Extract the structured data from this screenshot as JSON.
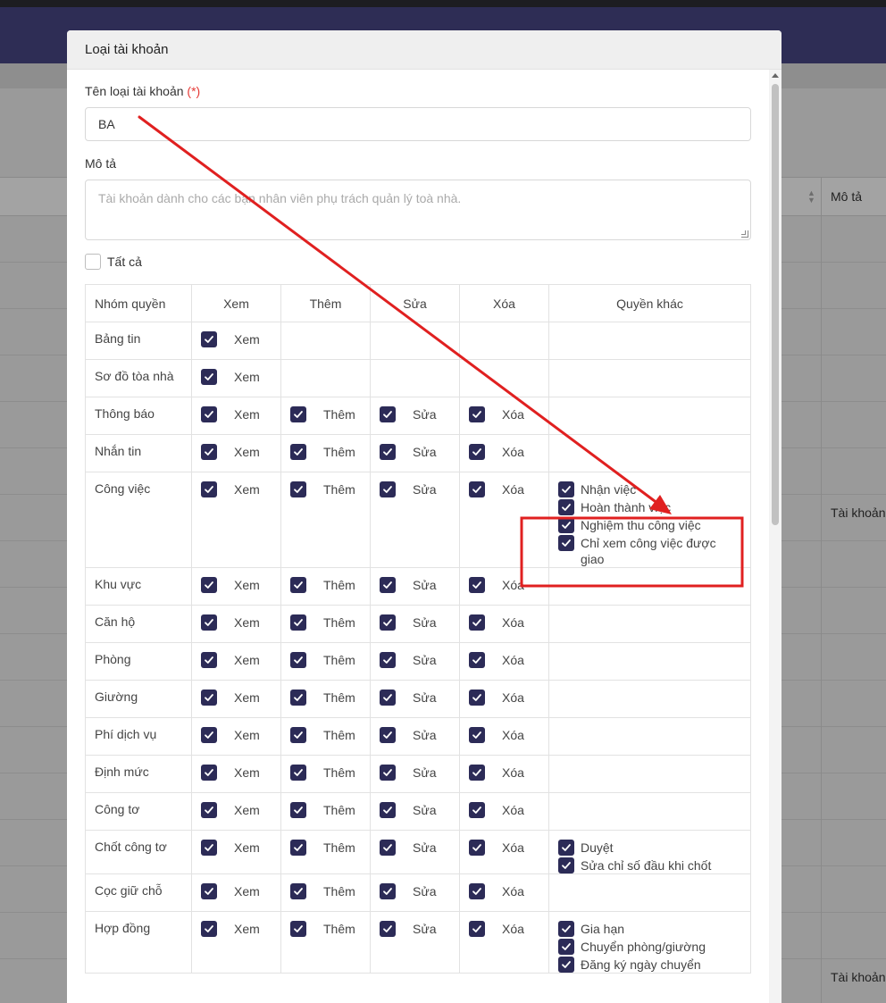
{
  "background": {
    "column_header": "Mô tả",
    "cells": [
      "Tài khoản",
      "Tài khoản"
    ]
  },
  "modal": {
    "title": "Loại tài khoản",
    "name_label": "Tên loại tài khoản",
    "required_mark": "(*)",
    "name_value": "BA",
    "desc_label": "Mô tả",
    "desc_placeholder": "Tài khoản dành cho các bạn nhân viên phụ trách quản lý toà nhà.",
    "select_all_label": "Tất cả",
    "table": {
      "headers": [
        "Nhóm quyền",
        "Xem",
        "Thêm",
        "Sửa",
        "Xóa",
        "Quyền khác"
      ],
      "action_labels": {
        "view": "Xem",
        "add": "Thêm",
        "edit": "Sửa",
        "delete": "Xóa"
      },
      "rows": [
        {
          "group": "Bảng tin",
          "view": true,
          "add": false,
          "edit": false,
          "delete": false,
          "other": []
        },
        {
          "group": "Sơ đồ tòa nhà",
          "view": true,
          "add": false,
          "edit": false,
          "delete": false,
          "other": []
        },
        {
          "group": "Thông báo",
          "view": true,
          "add": true,
          "edit": true,
          "delete": true,
          "other": []
        },
        {
          "group": "Nhắn tin",
          "view": true,
          "add": true,
          "edit": true,
          "delete": true,
          "other": []
        },
        {
          "group": "Công việc",
          "view": true,
          "add": true,
          "edit": true,
          "delete": true,
          "other": [
            "Nhận việc",
            "Hoàn thành việc",
            "Nghiệm thu công việc",
            "Chỉ xem công việc được giao"
          ]
        },
        {
          "group": "Khu vực",
          "view": true,
          "add": true,
          "edit": true,
          "delete": true,
          "other": []
        },
        {
          "group": "Căn hộ",
          "view": true,
          "add": true,
          "edit": true,
          "delete": true,
          "other": []
        },
        {
          "group": "Phòng",
          "view": true,
          "add": true,
          "edit": true,
          "delete": true,
          "other": []
        },
        {
          "group": "Giường",
          "view": true,
          "add": true,
          "edit": true,
          "delete": true,
          "other": []
        },
        {
          "group": "Phí dịch vụ",
          "view": true,
          "add": true,
          "edit": true,
          "delete": true,
          "other": []
        },
        {
          "group": "Định mức",
          "view": true,
          "add": true,
          "edit": true,
          "delete": true,
          "other": []
        },
        {
          "group": "Công tơ",
          "view": true,
          "add": true,
          "edit": true,
          "delete": true,
          "other": []
        },
        {
          "group": "Chốt công tơ",
          "view": true,
          "add": true,
          "edit": true,
          "delete": true,
          "other": [
            "Duyệt",
            "Sửa chỉ số đầu khi chốt"
          ]
        },
        {
          "group": "Cọc giữ chỗ",
          "view": true,
          "add": true,
          "edit": true,
          "delete": true,
          "other": []
        },
        {
          "group": "Hợp đồng",
          "view": true,
          "add": true,
          "edit": true,
          "delete": true,
          "other": [
            "Gia hạn",
            "Chuyển phòng/giường",
            "Đăng ký ngày chuyển"
          ]
        }
      ]
    }
  },
  "colors": {
    "checkbox": "#2c2b57",
    "annotation": "#e02020",
    "header_bar": "#2e2d55"
  }
}
